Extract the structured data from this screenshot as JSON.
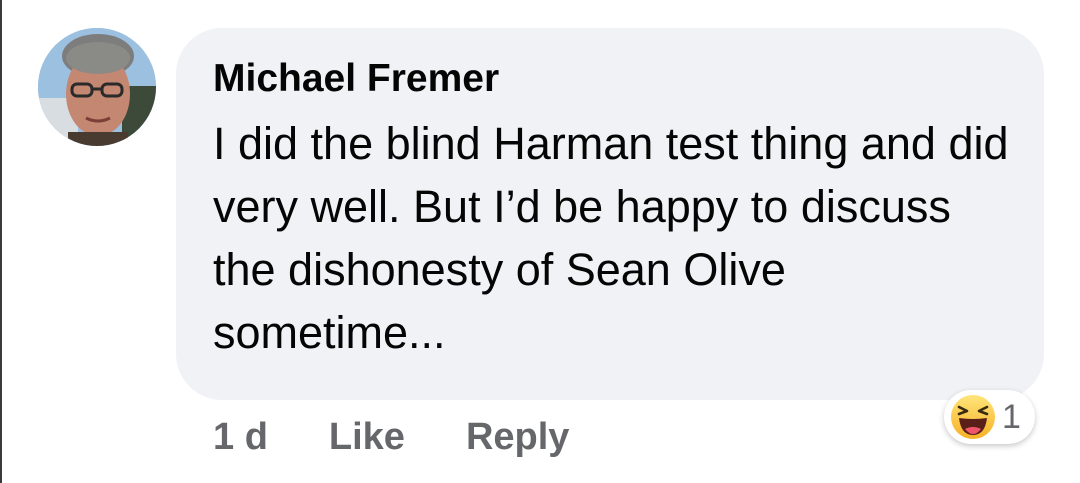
{
  "comment": {
    "author": "Michael Fremer",
    "text": "I did the blind Harman test thing and did very well. But I’d be happy to discuss the dishonesty of Sean Olive sometime...",
    "timestamp": "1 d",
    "like_label": "Like",
    "reply_label": "Reply"
  },
  "reactions": {
    "icon": "haha-emoji-icon",
    "count": "1"
  },
  "colors": {
    "bubble": "#f0f2f5",
    "text": "#050505",
    "secondary_text": "#65676b"
  }
}
